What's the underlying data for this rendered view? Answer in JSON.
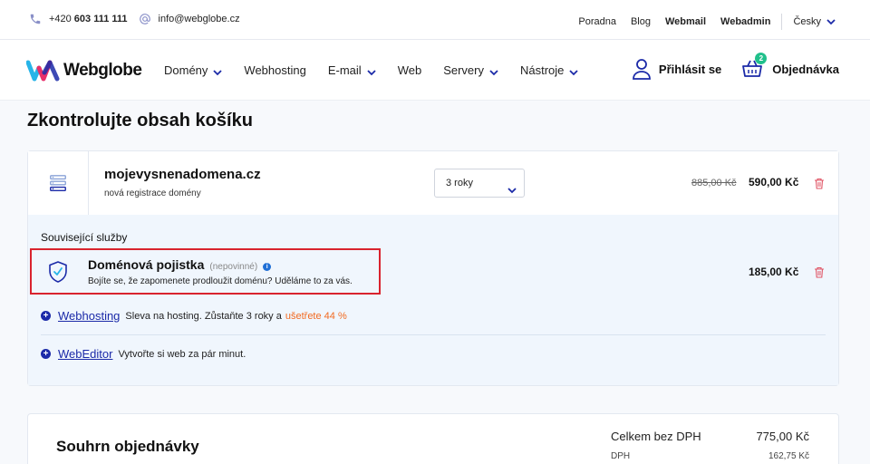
{
  "topbar": {
    "phone_prefix": "+420",
    "phone_number": "603 111 111",
    "email": "info@webglobe.cz",
    "links": [
      "Poradna",
      "Blog",
      "Webmail",
      "Webadmin"
    ],
    "language": "Česky"
  },
  "nav": {
    "logo_text": "Webglobe",
    "menu": [
      {
        "label": "Domény",
        "has_dropdown": true
      },
      {
        "label": "Webhosting",
        "has_dropdown": false
      },
      {
        "label": "E-mail",
        "has_dropdown": true
      },
      {
        "label": "Web",
        "has_dropdown": false
      },
      {
        "label": "Servery",
        "has_dropdown": true
      },
      {
        "label": "Nástroje",
        "has_dropdown": true
      }
    ],
    "login": "Přihlásit se",
    "order": "Objednávka",
    "cart_count": "2"
  },
  "page_title": "Zkontrolujte obsah košíku",
  "domain_item": {
    "name": "mojevysnenadomena.cz",
    "subtitle": "nová registrace domény",
    "period": "3 roky",
    "old_price": "885,00 Kč",
    "price": "590,00 Kč"
  },
  "related": {
    "title": "Související služby",
    "insurance": {
      "title": "Doménová pojistka",
      "optional": "(nepovinné)",
      "info": "i",
      "description": "Bojíte se, že zapomenete prodloužit doménu? Uděláme to za vás.",
      "price": "185,00 Kč"
    },
    "webhosting": {
      "link": "Webhosting",
      "text": "Sleva na hosting. Zůstaňte 3 roky a",
      "highlight": "ušetřete 44 %"
    },
    "webeditor": {
      "link": "WebEditor",
      "text": "Vytvořte si web za pár minut."
    }
  },
  "summary": {
    "title": "Souhrn objednávky",
    "total_label": "Celkem bez DPH",
    "total_value": "775,00 Kč",
    "vat_label": "DPH",
    "vat_value": "162,75 Kč"
  },
  "colors": {
    "brand_blue": "#1b2aa8",
    "accent_orange": "#f26a21",
    "badge_green": "#21c08b",
    "highlight_red": "#d9232e",
    "trash_red": "#e05566"
  }
}
